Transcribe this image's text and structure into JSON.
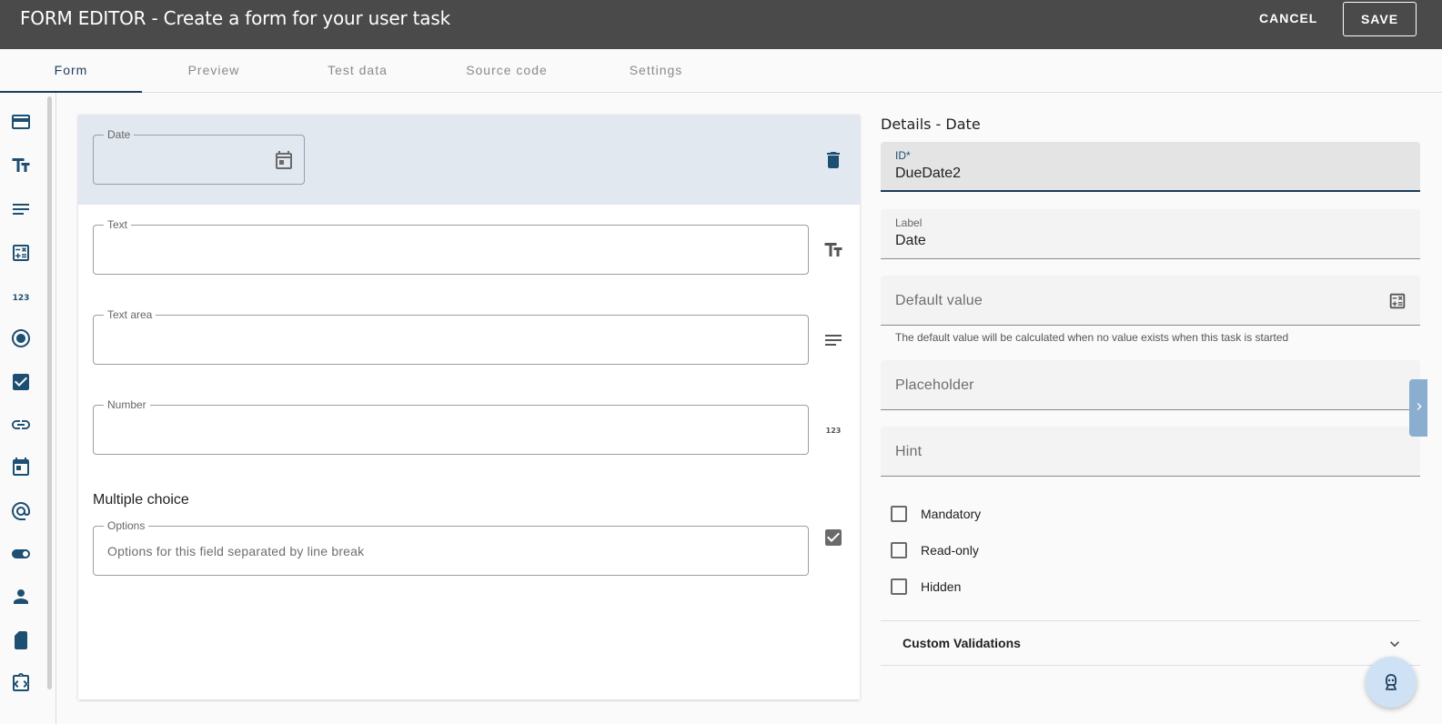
{
  "header": {
    "title": "FORM EDITOR - Create a form for your user task",
    "cancel_label": "CANCEL",
    "save_label": "SAVE"
  },
  "tabs": [
    {
      "label": "Form",
      "active": true
    },
    {
      "label": "Preview",
      "active": false
    },
    {
      "label": "Test data",
      "active": false
    },
    {
      "label": "Source code",
      "active": false
    },
    {
      "label": "Settings",
      "active": false
    }
  ],
  "toolbox": [
    {
      "icon": "card-icon"
    },
    {
      "icon": "text-field-icon"
    },
    {
      "icon": "text-area-icon"
    },
    {
      "icon": "calculator-icon"
    },
    {
      "icon": "number-icon"
    },
    {
      "icon": "radio-icon"
    },
    {
      "icon": "checkbox-icon"
    },
    {
      "icon": "link-icon"
    },
    {
      "icon": "calendar-icon"
    },
    {
      "icon": "email-icon"
    },
    {
      "icon": "toggle-icon"
    },
    {
      "icon": "user-icon"
    },
    {
      "icon": "file-icon"
    },
    {
      "icon": "code-icon"
    }
  ],
  "form": {
    "date_label": "Date",
    "text_label": "Text",
    "textarea_label": "Text area",
    "number_label": "Number",
    "multiple_choice_title": "Multiple choice",
    "options_label": "Options",
    "options_placeholder": "Options for this field separated by line break",
    "number_icon_text": "123"
  },
  "details": {
    "title": "Details - Date",
    "id_label": "ID*",
    "id_value": "DueDate2",
    "label_label": "Label",
    "label_value": "Date",
    "default_placeholder": "Default value",
    "default_hint": "The default value will be calculated when no value exists when this task is started",
    "placeholder_placeholder": "Placeholder",
    "hint_placeholder": "Hint",
    "mandatory_label": "Mandatory",
    "readonly_label": "Read-only",
    "hidden_label": "Hidden",
    "custom_validations_label": "Custom Validations"
  },
  "colors": {
    "header_bg": "#4a4a4a",
    "accent": "#1d3c59",
    "selected_row": "#e1e8f0",
    "fab_bg": "#cfe2f5"
  }
}
